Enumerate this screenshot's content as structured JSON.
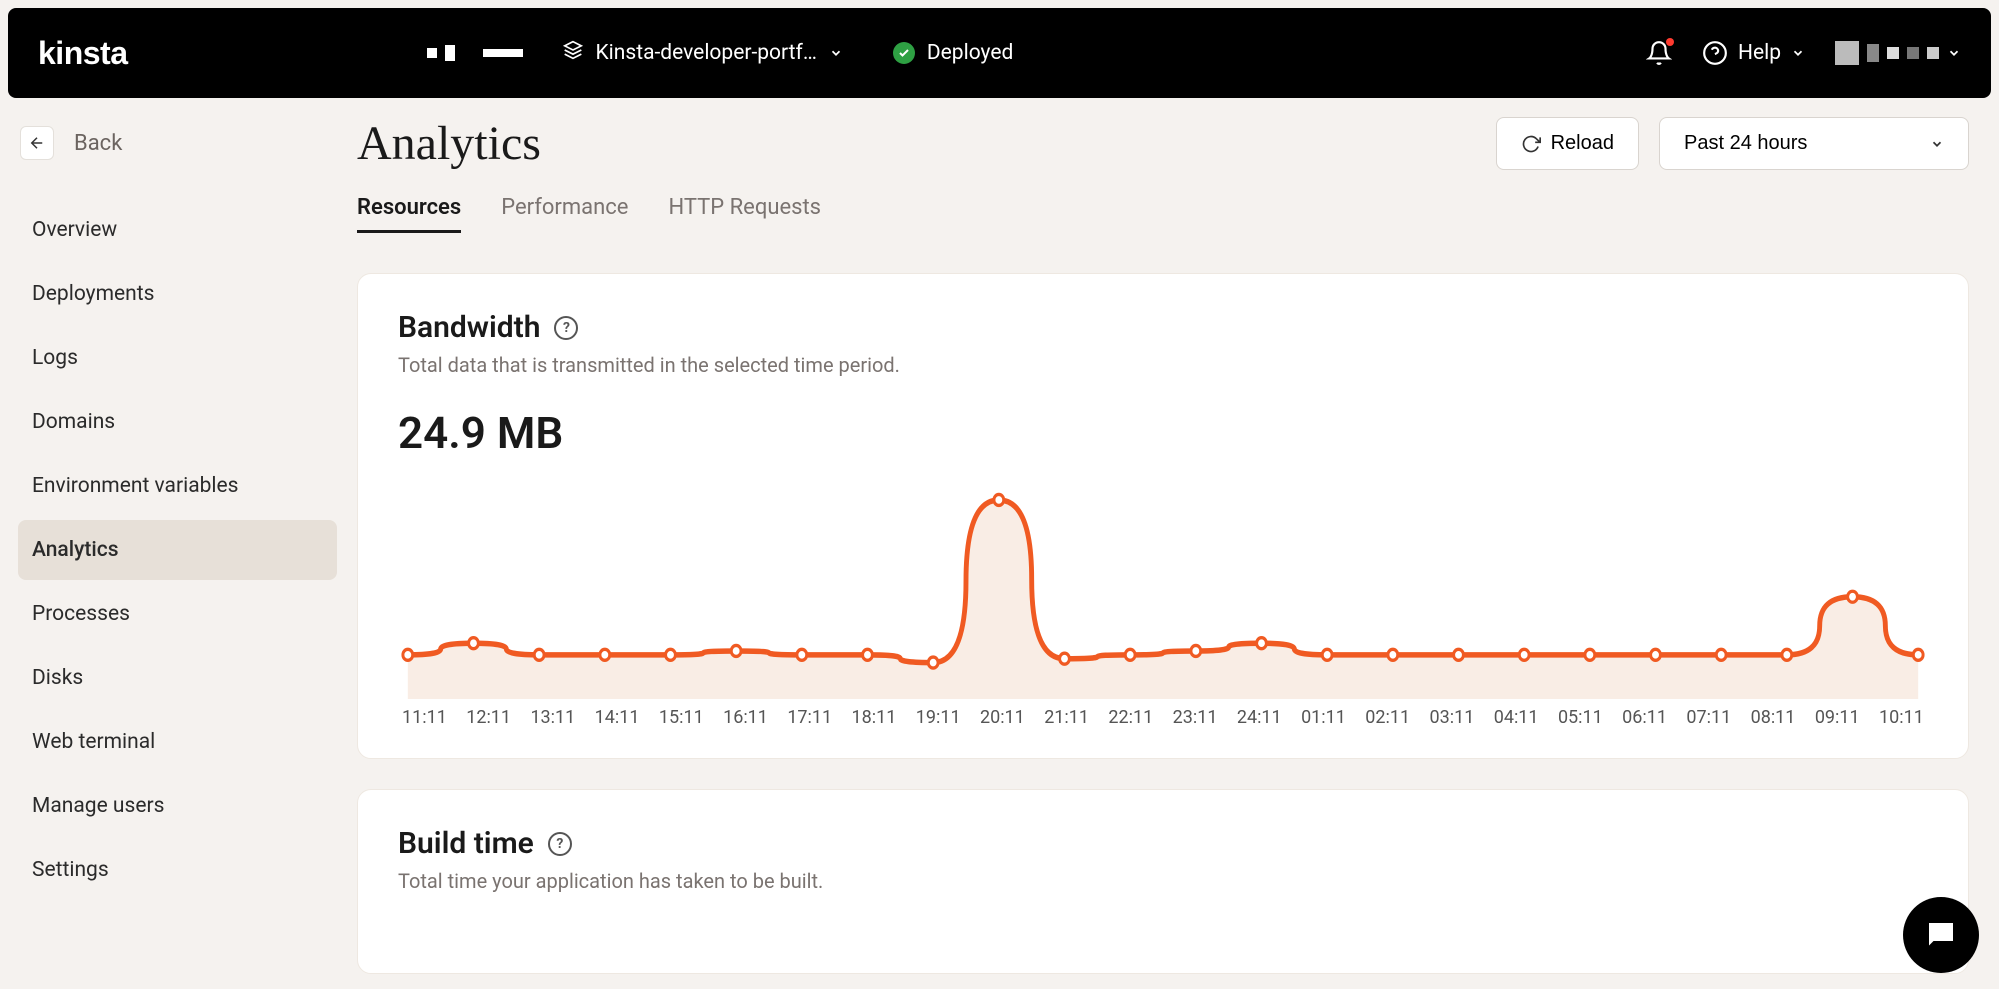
{
  "brand": "kinsta",
  "header": {
    "site_name": "Kinsta-developer-portf…",
    "status": "Deployed",
    "help_label": "Help"
  },
  "back_label": "Back",
  "sidebar": {
    "items": [
      {
        "label": "Overview"
      },
      {
        "label": "Deployments"
      },
      {
        "label": "Logs"
      },
      {
        "label": "Domains"
      },
      {
        "label": "Environment variables"
      },
      {
        "label": "Analytics"
      },
      {
        "label": "Processes"
      },
      {
        "label": "Disks"
      },
      {
        "label": "Web terminal"
      },
      {
        "label": "Manage users"
      },
      {
        "label": "Settings"
      }
    ],
    "active_index": 5
  },
  "page": {
    "title": "Analytics",
    "reload_label": "Reload",
    "range_label": "Past 24 hours",
    "tabs": [
      "Resources",
      "Performance",
      "HTTP Requests"
    ],
    "active_tab": 0,
    "bandwidth_card": {
      "title": "Bandwidth",
      "subtitle": "Total data that is transmitted in the selected time period.",
      "value": "24.9 MB"
    },
    "buildtime_card": {
      "title": "Build time",
      "subtitle": "Total time your application has taken to be built."
    }
  },
  "chart_data": {
    "type": "line",
    "title": "Bandwidth",
    "xlabel": "",
    "ylabel": "",
    "categories": [
      "11:11",
      "12:11",
      "13:11",
      "14:11",
      "15:11",
      "16:11",
      "17:11",
      "18:11",
      "19:11",
      "20:11",
      "21:11",
      "22:11",
      "23:11",
      "24:11",
      "01:11",
      "02:11",
      "03:11",
      "04:11",
      "05:11",
      "06:11",
      "07:11",
      "08:11",
      "09:11",
      "10:11"
    ],
    "values": [
      0.8,
      1.1,
      0.8,
      0.8,
      0.8,
      0.9,
      0.8,
      0.8,
      0.6,
      4.8,
      0.7,
      0.8,
      0.9,
      1.1,
      0.8,
      0.8,
      0.8,
      0.8,
      0.8,
      0.8,
      0.8,
      0.8,
      2.3,
      0.8
    ],
    "ylim": [
      0,
      5
    ]
  }
}
